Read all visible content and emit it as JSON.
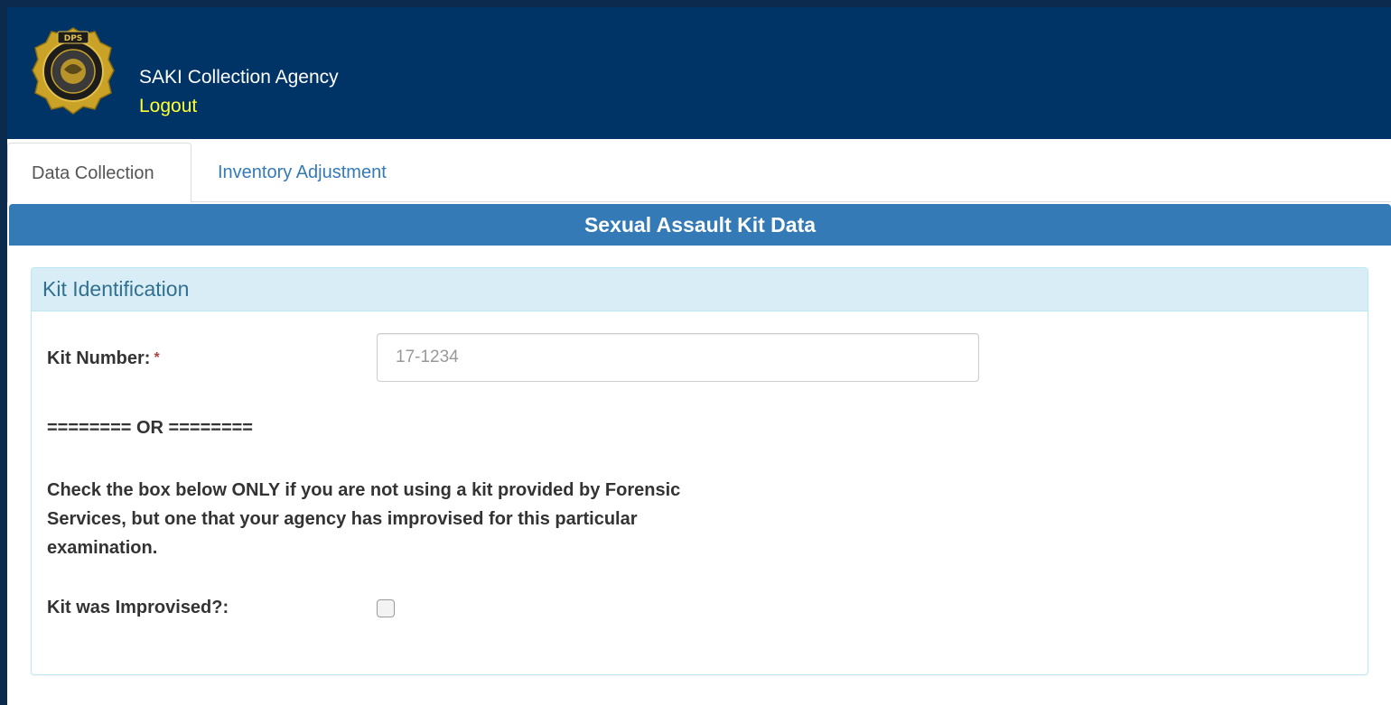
{
  "header": {
    "agency_name": "SAKI Collection Agency",
    "logout_label": "Logout"
  },
  "tabs": [
    {
      "label": "Data Collection",
      "active": true
    },
    {
      "label": "Inventory Adjustment",
      "active": false
    }
  ],
  "section_title": "Sexual Assault Kit Data",
  "kit_identification": {
    "heading": "Kit Identification",
    "kit_number_label": "Kit Number:",
    "required_marker": "*",
    "kit_number_placeholder": "17-1234",
    "kit_number_value": "",
    "or_divider": "======== OR ========",
    "instruction": "Check the box below ONLY if you are not using a kit provided by Forensic Services, but one that your agency has improvised for this particular examination.",
    "improvised_label": "Kit was Improvised?:",
    "improvised_checked": false
  },
  "colors": {
    "header_bg": "#003366",
    "logout_link": "#ffff33",
    "section_bar": "#337ab7",
    "panel_heading_bg": "#d9edf7",
    "panel_heading_text": "#31708f",
    "required": "#a94442"
  }
}
